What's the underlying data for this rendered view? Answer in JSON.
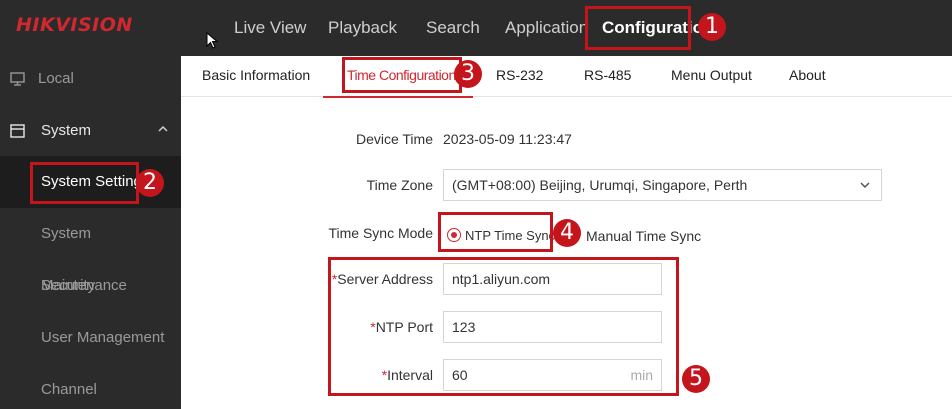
{
  "brand": {
    "logo_text": "HIKVISION"
  },
  "nav": {
    "items": [
      {
        "label": "Live View"
      },
      {
        "label": "Playback"
      },
      {
        "label": "Search"
      },
      {
        "label": "Application"
      },
      {
        "label": "Configuratio"
      }
    ]
  },
  "sidebar": {
    "local_label": "Local",
    "system_label": "System",
    "items": [
      {
        "label": "System Settings"
      },
      {
        "label": "System Maintenance"
      },
      {
        "label": "Security"
      },
      {
        "label": "User Management"
      },
      {
        "label": "Channel Management"
      }
    ]
  },
  "subtabs": [
    {
      "label": "Basic Information"
    },
    {
      "label": "Time Configuration"
    },
    {
      "label": "RS-232"
    },
    {
      "label": "RS-485"
    },
    {
      "label": "Menu Output"
    },
    {
      "label": "About"
    }
  ],
  "form": {
    "device_time_label": "Device Time",
    "device_time_value": "2023-05-09 11:23:47",
    "time_zone_label": "Time Zone",
    "time_zone_value": "(GMT+08:00) Beijing, Urumqi, Singapore, Perth",
    "sync_mode_label": "Time Sync Mode",
    "sync_ntp_label": "NTP Time Sync",
    "sync_manual_label": "Manual Time Sync",
    "required_mark": "*",
    "server_label": "Server Address",
    "server_value": "ntp1.aliyun.com",
    "port_label": "NTP Port",
    "port_value": "123",
    "interval_label": "Interval",
    "interval_value": "60",
    "interval_unit": "min"
  },
  "callouts": [
    "1",
    "2",
    "3",
    "4",
    "5"
  ],
  "colors": {
    "accent": "#d1272f",
    "callout": "#c4141c",
    "topbar": "#2b2b2b"
  },
  "icons": {
    "local": "monitor-icon",
    "system": "system-icon",
    "chevron": "chevron-up-icon",
    "select": "chevron-down-icon",
    "cursor": "mouse-cursor-icon"
  }
}
